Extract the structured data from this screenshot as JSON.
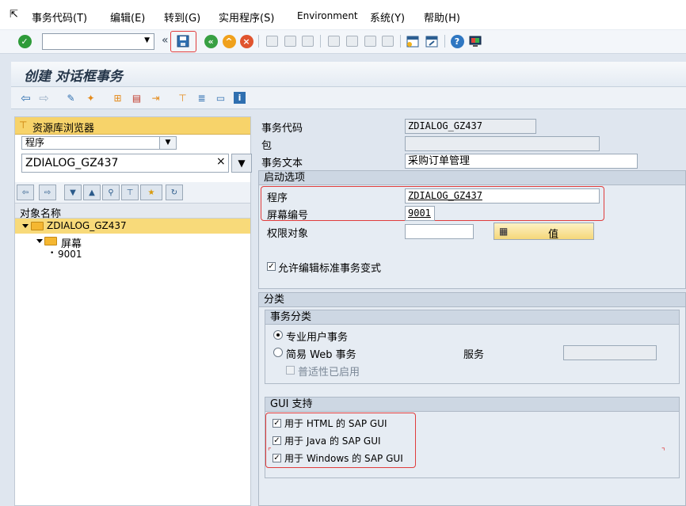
{
  "menu": {
    "items": [
      {
        "label": "事务代码(T)"
      },
      {
        "label": "编辑(E)"
      },
      {
        "label": "转到(G)"
      },
      {
        "label": "实用程序(S)"
      },
      {
        "label": "Environment"
      },
      {
        "label": "系统(Y)"
      },
      {
        "label": "帮助(H)"
      }
    ]
  },
  "toolbar": {
    "command_field_value": "",
    "colors": {
      "ok_green": "#2e9b39",
      "save_highlight": "#e03c3c"
    }
  },
  "title": "创建 对话框事务",
  "navigator": {
    "header": "资源库浏览器",
    "object_type": "程序",
    "object_name": "ZDIALOG_GZ437",
    "column_header": "对象名称",
    "tree": [
      {
        "label": "ZDIALOG_GZ437"
      },
      {
        "label": "屏幕"
      },
      {
        "label": "9001"
      }
    ]
  },
  "form": {
    "tcode_label": "事务代码",
    "tcode_value": "ZDIALOG_GZ437",
    "package_label": "包",
    "package_value": "",
    "text_label": "事务文本",
    "text_value": "采购订单管理",
    "start_section": "启动选项",
    "program_label": "程序",
    "program_value": "ZDIALOG_GZ437",
    "screen_label": "屏幕编号",
    "screen_value": "9001",
    "auth_label": "权限对象",
    "auth_value": "",
    "value_button": "值",
    "allow_variant_label": "允许编辑标准事务变式",
    "classification_section": "分类",
    "tx_class_group": "事务分类",
    "radio_pro": "专业用户事务",
    "radio_easy_web": "简易 Web 事务",
    "service_label": "服务",
    "service_value": "",
    "pervasive_label": "普适性已启用",
    "gui_group": "GUI 支持",
    "gui_html": "用于 HTML 的 SAP GUI",
    "gui_java": "用于 Java 的 SAP GUI",
    "gui_windows": "用于 Windows 的 SAP GUI"
  }
}
